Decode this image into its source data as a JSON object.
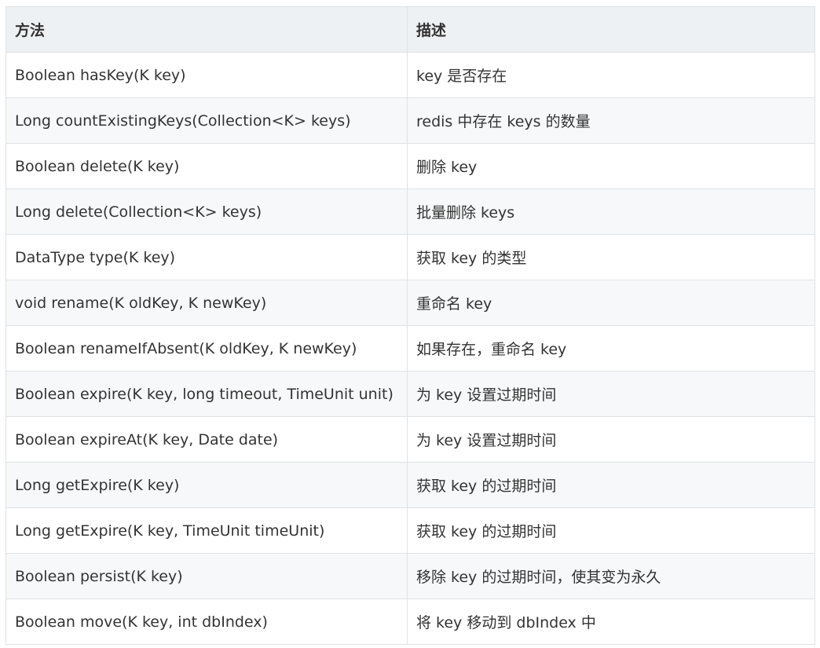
{
  "table": {
    "headers": [
      "方法",
      "描述"
    ],
    "rows": [
      [
        "Boolean hasKey(K key)",
        "key 是否存在"
      ],
      [
        "Long countExistingKeys(Collection<K> keys)",
        "redis 中存在 keys 的数量"
      ],
      [
        "Boolean delete(K key)",
        "删除 key"
      ],
      [
        "Long delete(Collection<K> keys)",
        "批量删除 keys"
      ],
      [
        "DataType type(K key)",
        "获取 key 的类型"
      ],
      [
        "void rename(K oldKey, K newKey)",
        "重命名 key"
      ],
      [
        "Boolean renameIfAbsent(K oldKey, K newKey)",
        "如果存在，重命名 key"
      ],
      [
        "Boolean expire(K key, long timeout, TimeUnit unit)",
        "为 key 设置过期时间"
      ],
      [
        "Boolean expireAt(K key, Date date)",
        "为 key 设置过期时间"
      ],
      [
        "Long getExpire(K key)",
        "获取 key 的过期时间"
      ],
      [
        "Long getExpire(K key, TimeUnit timeUnit)",
        "获取 key 的过期时间"
      ],
      [
        "Boolean persist(K key)",
        "移除 key 的过期时间，使其变为永久"
      ],
      [
        "Boolean move(K key, int dbIndex)",
        "将 key 移动到 dbIndex 中"
      ]
    ]
  }
}
